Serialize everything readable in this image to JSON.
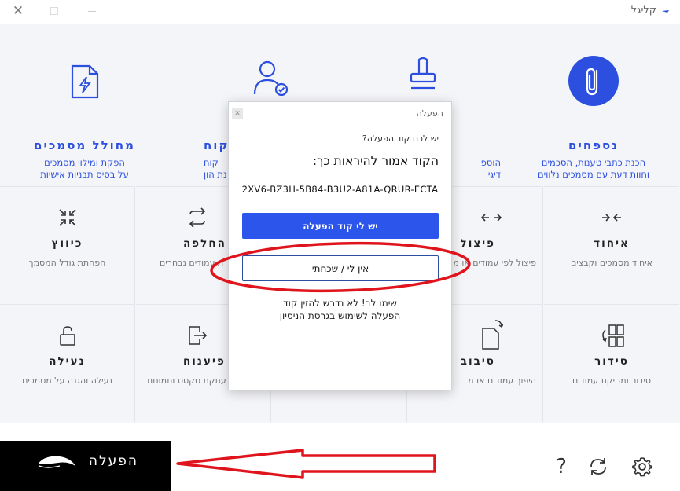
{
  "window": {
    "title": "קליגל"
  },
  "cards": [
    {
      "title": "נספחים",
      "sub1": "הכנת כתבי טענות, הסכמים",
      "sub2": "וחוות דעת עם מסמכים נלווים"
    },
    {
      "title": "",
      "sub1": "הוספ",
      "sub2": "דיגי"
    },
    {
      "title": "קוח",
      "sub1": "קוח",
      "sub2": "נת הון"
    },
    {
      "title": "מחולל מסמכים",
      "sub1": "הפקת ומילוי מסמכים",
      "sub2": "על בסיס תבניות אישיות"
    }
  ],
  "tools_row1": [
    {
      "title": "איחוד",
      "sub": "איחוד מסמכים וקבצים"
    },
    {
      "title": "פיצול",
      "sub": "פיצול לפי עמודים או מ"
    },
    {
      "title": "",
      "sub": ""
    },
    {
      "title": "החלפה",
      "sub": "ת עמודים נבחרים"
    },
    {
      "title": "כיווץ",
      "sub": "הפחתת גודל המסמך"
    }
  ],
  "tools_row2": [
    {
      "title": "סידור",
      "sub": "סידור ומחיקת עמודים"
    },
    {
      "title": "סיבוב",
      "sub": "היפוך עמודים או מ"
    },
    {
      "title": "",
      "sub": ""
    },
    {
      "title": "פיענוח",
      "sub": "עתקת טקסט ותמונות"
    },
    {
      "title": "נעילה",
      "sub": "נעילה והגנה על מסמכים"
    }
  ],
  "modal": {
    "title": "הפעלה",
    "question": "יש לכם קוד הפעלה?",
    "heading": "הקוד אמור להיראות כך:",
    "sample_code": "2XV6-BZ3H-5B84-B3U2-A81A-QRUR-ECTA",
    "primary_button": "יש לי קוד הפעלה",
    "secondary_button": "אין לי / שכחתי",
    "note_line1": "שימו לב! לא נדרש להזין קוד",
    "note_line2": "הפעלה לשימוש בגרסת הניסיון"
  },
  "bottom": {
    "activate_label": "הפעלה",
    "help_label": "?"
  },
  "colors": {
    "accent": "#2c4fe0",
    "primary_button": "#2c55ec",
    "annotation": "#e0141c",
    "activate_bg": "#000000"
  }
}
